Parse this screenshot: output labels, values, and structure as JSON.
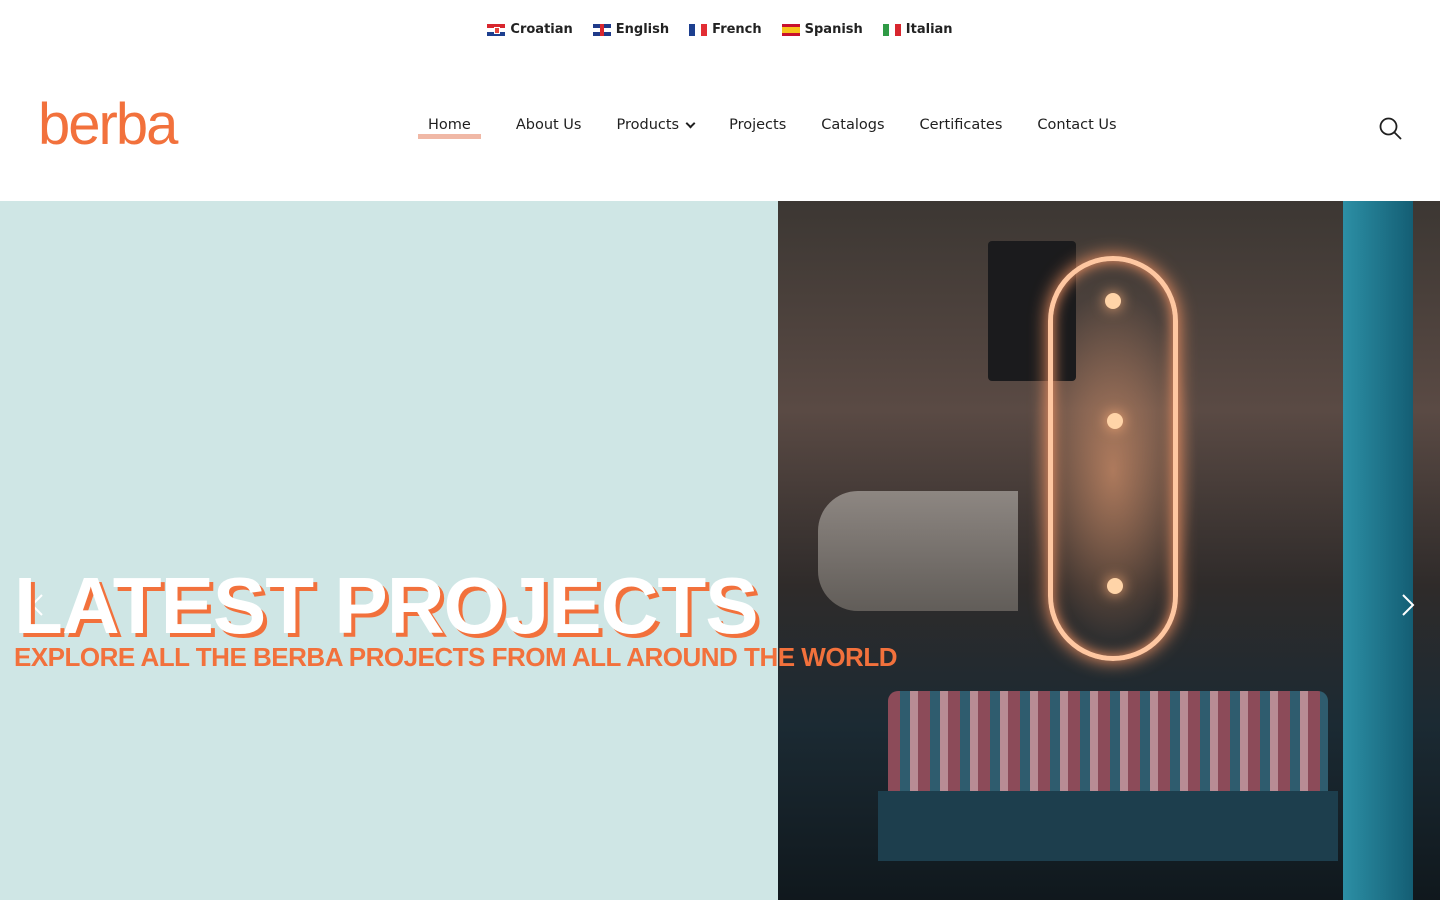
{
  "languages": [
    {
      "label": "Croatian",
      "flag": "croatia-flag-icon"
    },
    {
      "label": "English",
      "flag": "uk-flag-icon"
    },
    {
      "label": "French",
      "flag": "france-flag-icon"
    },
    {
      "label": "Spanish",
      "flag": "spain-flag-icon"
    },
    {
      "label": "Italian",
      "flag": "italy-flag-icon"
    }
  ],
  "header": {
    "logo": "berba",
    "search_icon": "search-icon"
  },
  "nav": {
    "items": [
      {
        "label": "Home",
        "active": true
      },
      {
        "label": "About Us"
      },
      {
        "label": "Products",
        "has_dropdown": true
      },
      {
        "label": "Projects"
      },
      {
        "label": "Catalogs"
      },
      {
        "label": "Certificates"
      },
      {
        "label": "Contact Us"
      }
    ]
  },
  "hero": {
    "title": "LATEST PROJECTS",
    "subtitle": "EXPLORE ALL THE BERBA PROJECTS FROM ALL AROUND THE WORLD",
    "prev_icon": "chevron-left-icon",
    "next_icon": "chevron-right-icon"
  },
  "colors": {
    "brand_orange": "#f2713c",
    "hero_background": "#cfe6e5",
    "active_underline": "#f0b8a6"
  }
}
